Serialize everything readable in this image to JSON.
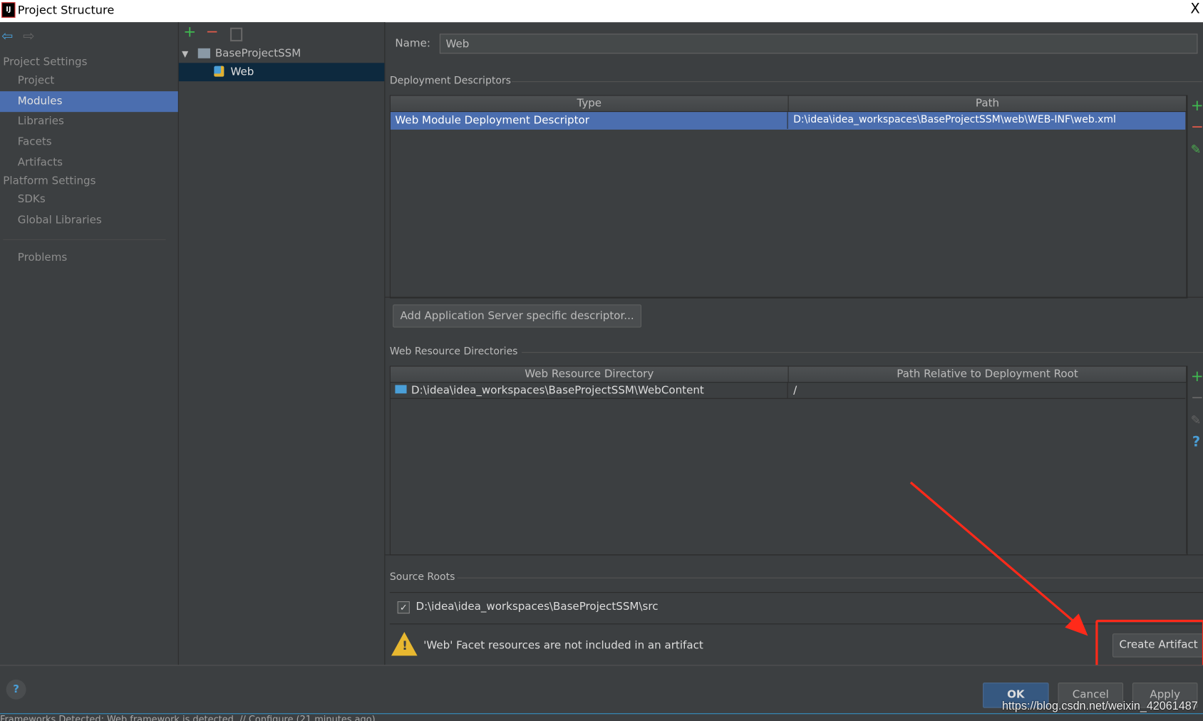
{
  "window": {
    "title": "Project Structure",
    "close": "X",
    "logo": "IJ"
  },
  "sidebar": {
    "project_settings": "Project Settings",
    "platform_settings": "Platform Settings",
    "items": [
      {
        "label": "Project"
      },
      {
        "label": "Modules"
      },
      {
        "label": "Libraries"
      },
      {
        "label": "Facets"
      },
      {
        "label": "Artifacts"
      },
      {
        "label": "SDKs"
      },
      {
        "label": "Global Libraries"
      },
      {
        "label": "Problems"
      }
    ],
    "selected": "Modules"
  },
  "tree": {
    "root": "BaseProjectSSM",
    "child": "Web"
  },
  "name_field": {
    "label": "Name:",
    "value": "Web"
  },
  "deployment": {
    "title": "Deployment Descriptors",
    "columns": [
      "Type",
      "Path"
    ],
    "rows": [
      {
        "type": "Web Module Deployment Descriptor",
        "path": "D:\\idea\\idea_workspaces\\BaseProjectSSM\\web\\WEB-INF\\web.xml"
      }
    ],
    "add_button": "Add Application Server specific descriptor..."
  },
  "web_resources": {
    "title": "Web Resource Directories",
    "columns": [
      "Web Resource Directory",
      "Path Relative to Deployment Root"
    ],
    "rows": [
      {
        "dir": "D:\\idea\\idea_workspaces\\BaseProjectSSM\\WebContent",
        "rel": "/"
      }
    ]
  },
  "source_roots": {
    "title": "Source Roots",
    "items": [
      {
        "path": "D:\\idea\\idea_workspaces\\BaseProjectSSM\\src",
        "checked": true
      }
    ]
  },
  "warning": {
    "text": "'Web' Facet resources are not included in an artifact",
    "button": "Create Artifact"
  },
  "footer": {
    "ok": "OK",
    "cancel": "Cancel",
    "apply": "Apply",
    "help": "?"
  },
  "status": "Frameworks Detected: Web framework is detected. // Configure (21 minutes ago)",
  "watermark": "https://blog.csdn.net/weixin_42061487",
  "colors": {
    "selection": "#4b6eaf",
    "tree_selection": "#0d293e",
    "annotation": "#ff2a1a",
    "ok": "#365880"
  }
}
